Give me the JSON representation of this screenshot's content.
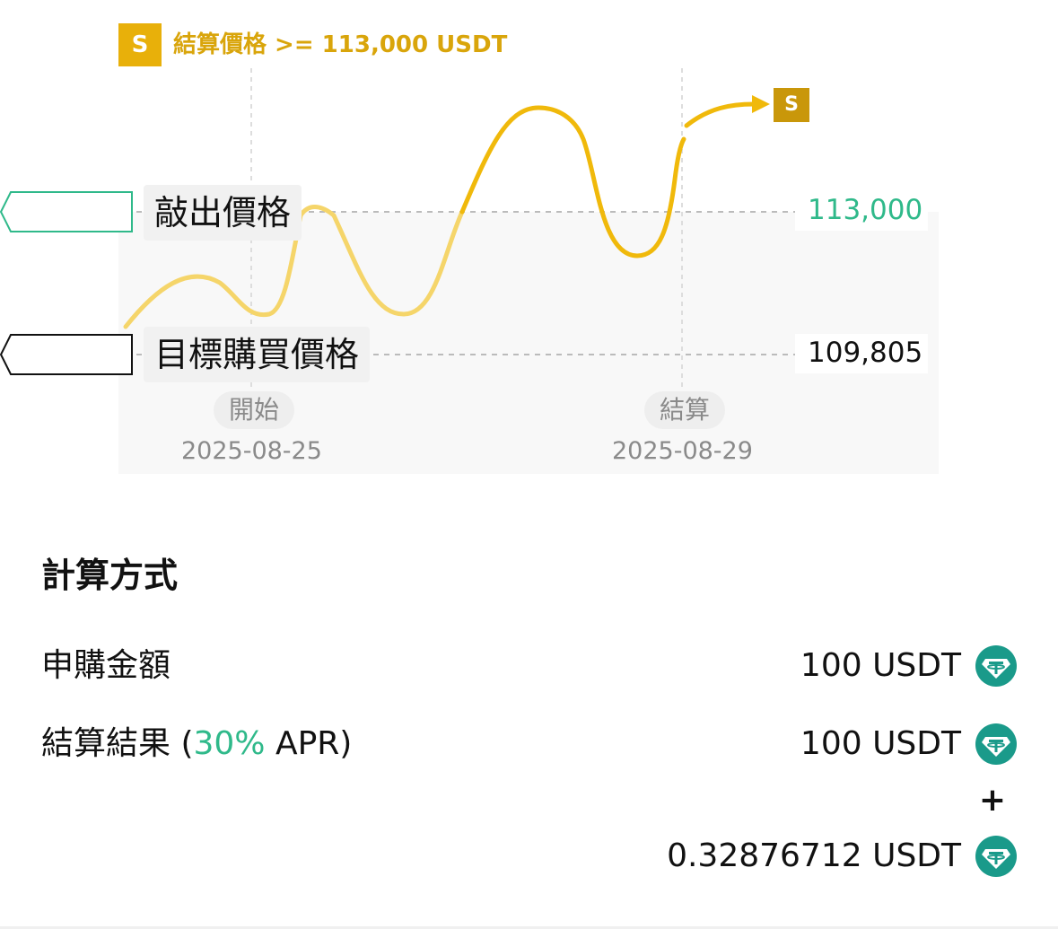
{
  "chart": {
    "header_badge": "S",
    "header_text": "結算價格 >= 113,000 USDT",
    "end_badge": "S",
    "strike_label": "敲出價格",
    "strike_value": "113,000",
    "target_label": "目標購買價格",
    "target_value": "109,805",
    "start_pill": "開始",
    "start_date": "2025-08-25",
    "end_pill": "結算",
    "end_date": "2025-08-29",
    "colors": {
      "curve": "#f0b90b",
      "curve_faded": "#f5d56a",
      "strike": "#2fb98a",
      "badge": "#e8b00a"
    }
  },
  "calculation": {
    "title": "計算方式",
    "subscription_label": "申購金額",
    "subscription_amount": "100 USDT",
    "settlement_label_prefix": "結算結果 (",
    "settlement_apr_pct": "30%",
    "settlement_label_suffix": " APR)",
    "settlement_amount": "100 USDT",
    "plus": "+",
    "interest_amount": "0.32876712 USDT",
    "icon": "usdt-tether-icon"
  }
}
